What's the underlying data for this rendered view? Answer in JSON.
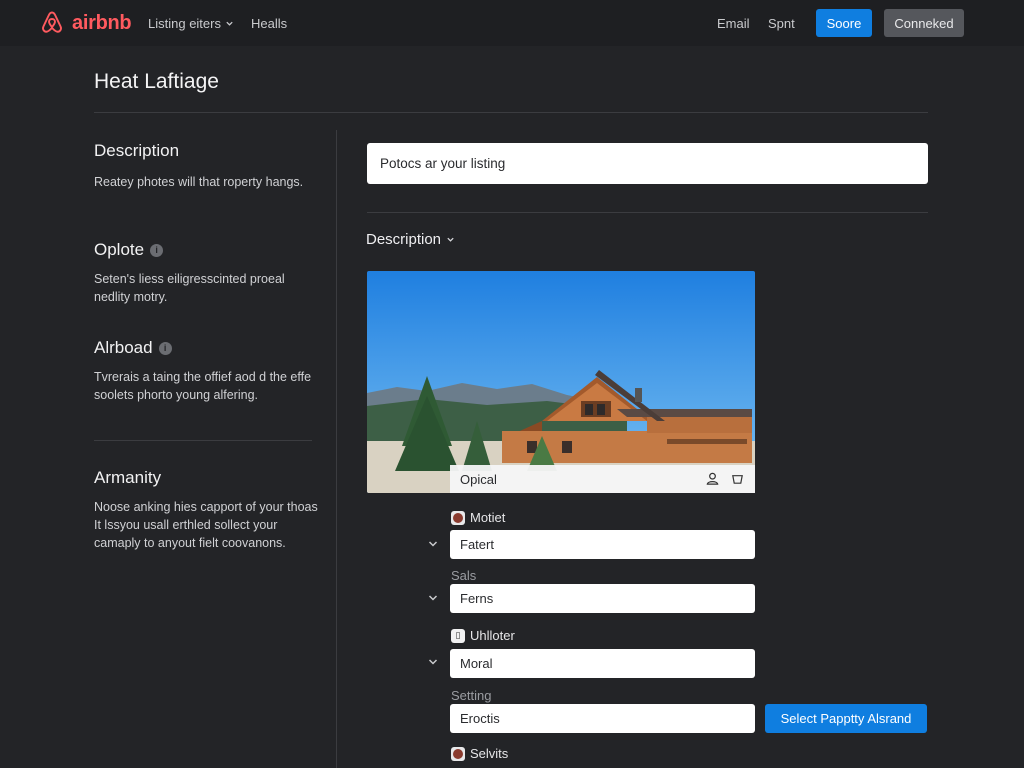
{
  "nav": {
    "brand": "airbnb",
    "links": [
      {
        "label": "Listing eiters",
        "has_dropdown": true
      },
      {
        "label": "Healls",
        "has_dropdown": false
      }
    ],
    "right_links": [
      "Email",
      "Spnt"
    ],
    "primary_button": "Soore",
    "secondary_button": "Conneked"
  },
  "page": {
    "title": "Heat Laftiage"
  },
  "sidebar": {
    "sections": [
      {
        "heading": "Description",
        "info": false,
        "body": "Reatey photes will that roperty hangs."
      },
      {
        "heading": "Oplote",
        "info": true,
        "body": "Seten's liess eiligresscinted proeal nedlity motry."
      },
      {
        "heading": "Alrboad",
        "info": true,
        "body": "Tvrerais a taing the offief aod d the effe soolets phorto young alfering."
      },
      {
        "heading": "Armanity",
        "info": false,
        "body": "Noose anking hies capport of your thoas It lssyou usall erthled sollect your camaply to anyout fielt coovanons."
      }
    ]
  },
  "main": {
    "search_placeholder": "Potocs ar your listing",
    "description_toggle": "Description",
    "photo_caption": "Opical",
    "rows": [
      {
        "label": "Motiet",
        "icon": "avatar-thumb",
        "value": "Fatert"
      },
      {
        "label": "Sals",
        "icon": "",
        "value": "Ferns"
      },
      {
        "label": "Uhlloter",
        "icon": "glyph",
        "value": "Moral"
      },
      {
        "label": "Setting",
        "icon": "",
        "value": "Eroctis"
      },
      {
        "label": "Selvits",
        "icon": "avatar-thumb",
        "value": ""
      }
    ],
    "cta_button": "Select Papptty Alsrand"
  },
  "colors": {
    "background": "#232427",
    "nav_background": "#1e1f22",
    "brand": "#ff5a5f",
    "accent_blue": "#0f7ee0",
    "secondary_button": "#55575c",
    "divider": "#3b3c40"
  },
  "icons": [
    "airbnb-logo-icon",
    "chevron-down-icon",
    "info-icon",
    "user-icon",
    "trash-icon"
  ]
}
